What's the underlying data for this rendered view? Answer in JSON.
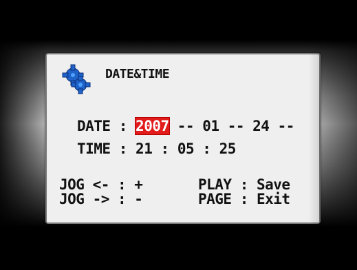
{
  "dialog": {
    "title": "DATE&TIME",
    "icon": "gear-icon",
    "date": {
      "label": "DATE",
      "colon": ":",
      "year": "2007",
      "sep1": "--",
      "month": "01",
      "sep2": "--",
      "day": "24",
      "sep3": "--"
    },
    "time": {
      "label": "TIME",
      "colon": ":",
      "hour": "21",
      "sep1": ":",
      "minute": "05",
      "sep2": ":",
      "second": "25"
    },
    "help": {
      "jog_left": "JOG <- : +",
      "jog_right": "JOG -> : -",
      "play": "PLAY : Save",
      "page": "PAGE : Exit"
    },
    "colors": {
      "selection": "#e21b1b",
      "panel": "#efefef",
      "gear_blue": "#1f63c9"
    }
  }
}
